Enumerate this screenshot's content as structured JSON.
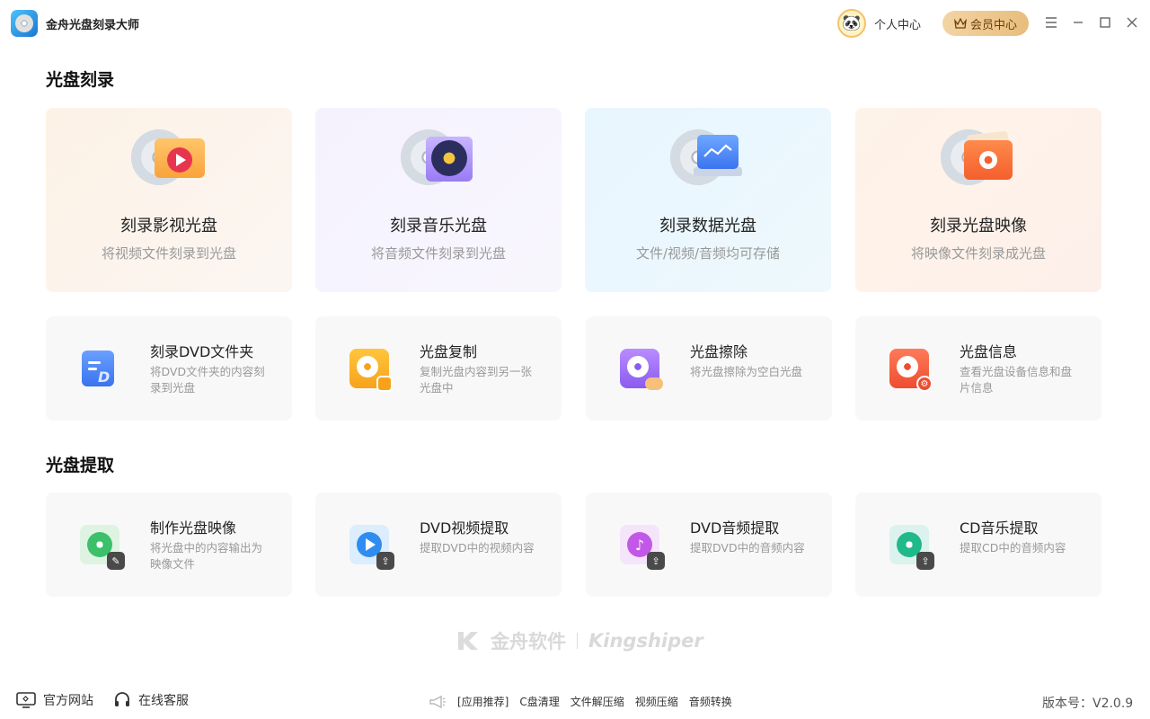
{
  "window": {
    "title": "金舟光盘刻录大师",
    "personal_center": "个人中心",
    "vip_center": "会员中心"
  },
  "burn_section": {
    "title": "光盘刻录",
    "big_cards": [
      {
        "title": "刻录影视光盘",
        "subtitle": "将视频文件刻录到光盘",
        "icon": "video-folder-disc-icon"
      },
      {
        "title": "刻录音乐光盘",
        "subtitle": "将音频文件刻录到光盘",
        "icon": "music-disc-icon"
      },
      {
        "title": "刻录数据光盘",
        "subtitle": "文件/视频/音频均可存储",
        "icon": "data-disc-icon"
      },
      {
        "title": "刻录光盘映像",
        "subtitle": "将映像文件刻录成光盘",
        "icon": "image-folder-disc-icon"
      }
    ],
    "small_cards": [
      {
        "title": "刻录DVD文件夹",
        "desc": "将DVD文件夹的内容刻录到光盘"
      },
      {
        "title": "光盘复制",
        "desc": "复制光盘内容到另一张光盘中"
      },
      {
        "title": "光盘擦除",
        "desc": "将光盘擦除为空白光盘"
      },
      {
        "title": "光盘信息",
        "desc": "查看光盘设备信息和盘片信息"
      }
    ]
  },
  "extract_section": {
    "title": "光盘提取",
    "cards": [
      {
        "title": "制作光盘映像",
        "desc": "将光盘中的内容输出为映像文件"
      },
      {
        "title": "DVD视频提取",
        "desc": "提取DVD中的视频内容"
      },
      {
        "title": "DVD音频提取",
        "desc": "提取DVD中的音频内容"
      },
      {
        "title": "CD音乐提取",
        "desc": "提取CD中的音频内容"
      }
    ]
  },
  "watermark": {
    "cn": "金舟软件",
    "en": "Kingshiper"
  },
  "footer": {
    "website": "官方网站",
    "support": "在线客服",
    "tools": [
      "[应用推荐]",
      "C盘清理",
      "文件解压缩",
      "视频压缩",
      "音频转换"
    ],
    "version": "版本号：V2.0.9"
  }
}
